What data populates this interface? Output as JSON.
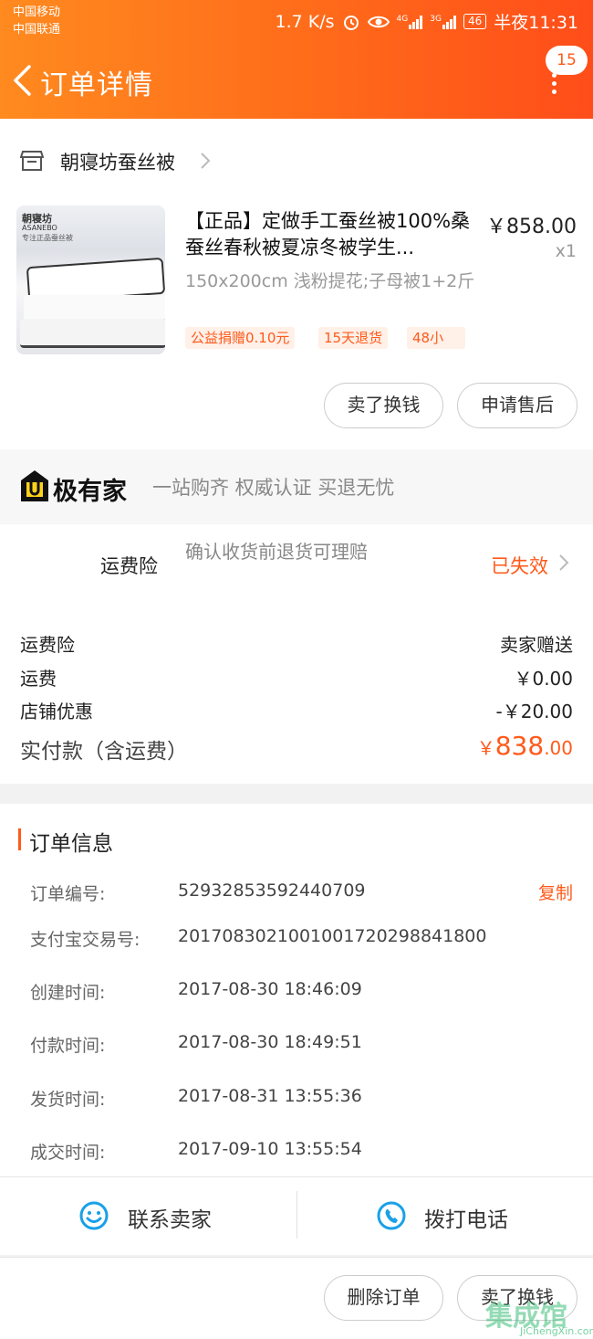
{
  "status_bar": {
    "carrier1": "中国移动",
    "carrier2": "中国联通",
    "speed": "1.7 K/s",
    "net1": "4G",
    "net2": "3G",
    "battery": "46",
    "time": "半夜11:31"
  },
  "header": {
    "title": "订单详情",
    "badge": "15"
  },
  "shop": {
    "name": "朝寝坊蚕丝被"
  },
  "product": {
    "image_caption": "朝寝坊",
    "image_caption2": "ASANEBO",
    "image_caption3": "专注正品蚕丝被",
    "title": "【正品】定做手工蚕丝被100%桑蚕丝春秋被夏凉冬被学生...",
    "price": "￥858.00",
    "qty": "x1",
    "spec": "150x200cm 浅粉提花;子母被1+2斤",
    "tags": [
      "公益捐赠0.10元",
      "15天退货",
      "48小"
    ]
  },
  "actions_top": {
    "sell": "卖了换钱",
    "after_sale": "申请售后"
  },
  "jiyoujia": {
    "name": "极有家",
    "slogan": "一站购齐 权威认证 买退无忧"
  },
  "insurance": {
    "label": "运费险",
    "desc": "确认收货前退货可理赔",
    "status": "已失效"
  },
  "fees": [
    {
      "label": "运费险",
      "value": "卖家赠送"
    },
    {
      "label": "运费",
      "value": "￥0.00"
    },
    {
      "label": "店铺优惠",
      "value": "-￥20.00"
    }
  ],
  "total": {
    "label": "实付款（含运费）",
    "currency": "￥",
    "integer": "838",
    "decimal": ".00"
  },
  "order_info": {
    "title": "订单信息",
    "copy": "复制",
    "rows": [
      {
        "key": "订单编号:",
        "value": "52932853592440709"
      },
      {
        "key": "支付宝交易号:",
        "value": "2017083021001001720298841800"
      },
      {
        "key": "创建时间:",
        "value": "2017-08-30 18:46:09"
      },
      {
        "key": "付款时间:",
        "value": "2017-08-30 18:49:51"
      },
      {
        "key": "发货时间:",
        "value": "2017-08-31 13:55:36"
      },
      {
        "key": "成交时间:",
        "value": "2017-09-10 13:55:54"
      }
    ]
  },
  "contact": {
    "seller": "联系卖家",
    "call": "拨打电话"
  },
  "bottom_actions": {
    "delete": "删除订单",
    "sell": "卖了换钱"
  },
  "watermark": {
    "main": "集成馆",
    "url": "JiChengXin.com"
  },
  "colors": {
    "accent": "#ff5a1a",
    "header_start": "#ff8a1f",
    "header_end": "#ff4d1a",
    "contact_icon": "#1aa0e8"
  }
}
